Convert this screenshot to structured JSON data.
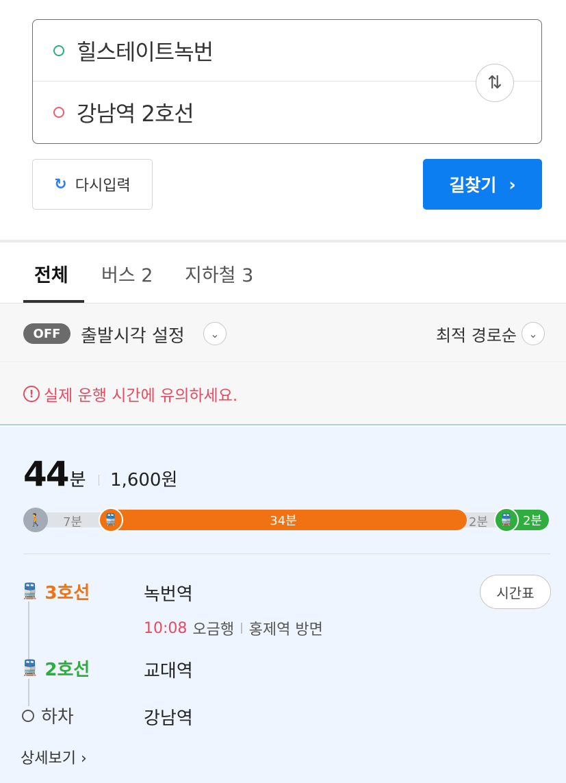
{
  "search": {
    "origin": "힐스테이트녹번",
    "destination": "강남역 2호선",
    "swap_icon": "swap-vertical-icon",
    "reset_label": "다시입력",
    "reset_icon": "refresh-icon",
    "search_label": "길찾기",
    "search_chevron": "›"
  },
  "tabs": [
    {
      "label": "전체",
      "active": true
    },
    {
      "label": "버스 2",
      "active": false
    },
    {
      "label": "지하철 3",
      "active": false
    }
  ],
  "options": {
    "toggle_label": "OFF",
    "departure_label": "출발시각 설정",
    "sort_label": "최적 경로순"
  },
  "notice": {
    "icon": "!",
    "text": "실제 운행 시간에 유의하세요."
  },
  "route": {
    "duration_value": "44",
    "duration_unit": "분",
    "fare": "1,600원",
    "timeline": {
      "walk_label": "7분",
      "line3_label": "34분",
      "transfer_label": "2분",
      "line2_label": "2분"
    },
    "steps": [
      {
        "line": "3호선",
        "station": "녹번역",
        "color": "#f07212"
      },
      {
        "line": "2호선",
        "station": "교대역",
        "color": "#2fae3f"
      },
      {
        "line": "하차",
        "station": "강남역",
        "color": "#555555"
      }
    ],
    "departure": {
      "time": "10:08",
      "train": "오금행",
      "direction": "홍제역 방면"
    },
    "timetable_label": "시간표",
    "detail_label": "상세보기 ›"
  },
  "colors": {
    "accent": "#0d7ef2",
    "line3": "#f07212",
    "line2": "#2fae3f",
    "warning": "#e84a5f"
  }
}
